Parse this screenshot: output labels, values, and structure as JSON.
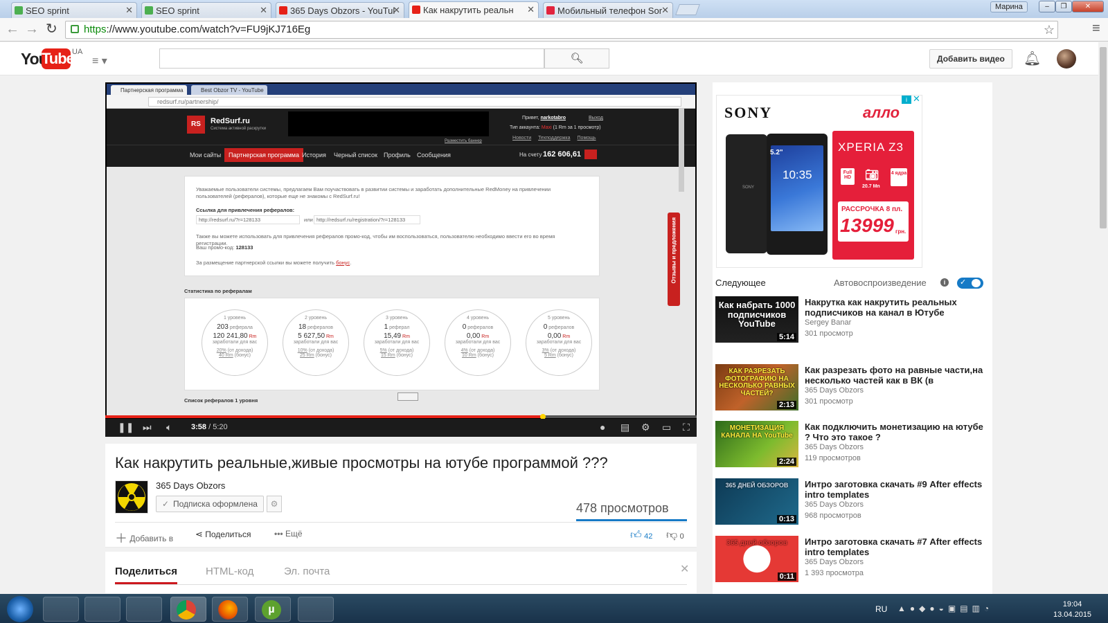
{
  "browser": {
    "tabs": [
      {
        "label": "SEO sprint",
        "favicon_color": "#4caf50"
      },
      {
        "label": "SEO sprint",
        "favicon_color": "#4caf50"
      },
      {
        "label": "365 Days Obzors - YouTul",
        "favicon_color": "#e62117"
      },
      {
        "label": "Как накрутить реальн",
        "favicon_color": "#e62117"
      },
      {
        "label": "Мобильный телефон Sor",
        "favicon_color": "#e2233d"
      }
    ],
    "user": "Марина",
    "url_scheme": "https",
    "url_rest": "://www.youtube.com/watch?v=FU9jKJ716Eg"
  },
  "youtube": {
    "logo_you": "You",
    "logo_tube": "Tube",
    "region": "UA",
    "add_video_label": "Добавить видео"
  },
  "player": {
    "time_current": "3:58",
    "time_total": "/ 5:20",
    "progress": 0.74
  },
  "inner": {
    "tab1": "Партнерская программа",
    "tab2": "Best Obzor TV - YouTube",
    "url": "redsurf.ru/partnership/",
    "site_name": "RedSurf.ru",
    "site_tagline": "Система активной раскрутки",
    "greeting": "Привет,",
    "username": "narkotabro",
    "logout": "Выход",
    "account_label": "Тип аккаунта:",
    "account_type": "Maxi",
    "account_note": "(1 Rm за 1 просмотр)",
    "banner_link": "Разместить баннер",
    "links": [
      "Новости",
      "Техподдержка",
      "Помощь"
    ],
    "nav": [
      "Мои сайты",
      "Партнерская программа",
      "История",
      "Черный список",
      "Профиль",
      "Сообщения"
    ],
    "balance_label": "На счету",
    "balance": "162 606,61",
    "intro": "Уважаемые пользователи системы, предлагаем Вам поучаствовать в развитии системы и заработать дополнительные RedMoney на привлечении пользователей (рефералов), которые еще не знакомы с RedSurf.ru!",
    "ref_link_label": "Ссылка для привлечения рефералов:",
    "ref_link1": "http://redsurf.ru/?r=128133",
    "or": "или",
    "ref_link2": "http://redsurf.ru/registration/?r=128133",
    "promo_text": "Также вы можете использовать для привлечения рефералов промо-код, чтобы им воспользоваться, пользователю необходимо ввести его во время регистрации.",
    "promo_label": "Ваш промо-код:",
    "promo_code": "128133",
    "bonus_text": "За размещение партнерской ссылки вы можете получить",
    "bonus_link": "бонус",
    "stats_title": "Статистика по рефералам",
    "list_title": "Список рефералов 1 уровня",
    "feedback": "Отзывы и предложения",
    "levels": [
      {
        "name": "1 уровень",
        "count": "203",
        "unit": "реферала",
        "sum": "120 241,80",
        "pct": "20%",
        "bonus": "40 Rm"
      },
      {
        "name": "2 уровень",
        "count": "18",
        "unit": "рефералов",
        "sum": "5 627,50",
        "pct": "10%",
        "bonus": "25 Rm"
      },
      {
        "name": "3 уровень",
        "count": "1",
        "unit": "реферал",
        "sum": "15,49",
        "pct": "5%",
        "bonus": "15 Rm"
      },
      {
        "name": "4 уровень",
        "count": "0",
        "unit": "рефералов",
        "sum": "0,00",
        "pct": "4%",
        "bonus": "10 Rm"
      },
      {
        "name": "5 уровень",
        "count": "0",
        "unit": "рефералов",
        "sum": "0,00",
        "pct": "3%",
        "bonus": "5 Rm"
      }
    ],
    "earned_label": "заработали для вас",
    "income_note": "(от дохода)",
    "bonus_note": "(бонус)",
    "rm": "Rm"
  },
  "video": {
    "title": "Как накрутить реальные,живые просмотры на ютубе программой ???",
    "channel": "365 Days Obzors",
    "subscribed_label": "Подписка оформлена",
    "views": "478 просмотров",
    "add_to": "Добавить в",
    "share": "Поделиться",
    "more": "Ещё",
    "likes": "42",
    "dislikes": "0"
  },
  "share_panel": {
    "tabs": [
      "Поделиться",
      "HTML-код",
      "Эл. почта"
    ]
  },
  "ad": {
    "brand": "SONY",
    "shop": "алло",
    "model": "XPERIA Z3",
    "icon1": "Full HD",
    "icon2": "20.7 Mn",
    "icon3": "4 ядра",
    "installment": "РАССРОЧКА 8 пл.",
    "price": "13999",
    "currency": "грн.",
    "phone_size": "5.2\"",
    "phone_time": "10:35"
  },
  "sidebar": {
    "next_label": "Следующее",
    "autoplay_label": "Автовоспроизведение",
    "autoplay_on": true,
    "items": [
      {
        "title": "Накрутка как накрутить реальных подписчиков на канал в Ютубе",
        "channel": "Sergey Banar",
        "views": "301 просмотр",
        "duration": "5:14",
        "thumb_text": "Как набрать 1000 подписчиков YouTube"
      },
      {
        "title": "Как разрезать фото на равные части,на несколько частей как в ВК (в",
        "channel": "365 Days Obzors",
        "views": "301 просмотр",
        "duration": "2:13",
        "thumb_text": "КАК РАЗРЕЗАТЬ ФОТОГРАФИЮ НА НЕСКОЛЬКО РАВНЫХ ЧАСТЕЙ?"
      },
      {
        "title": "Как подключить монетизацию на ютубе ? Что это такое ?",
        "channel": "365 Days Obzors",
        "views": "119 просмотров",
        "duration": "2:24",
        "thumb_text": "МОНЕТИЗАЦИЯ КАНАЛА НА YouTube"
      },
      {
        "title": "Интро заготовка скачать #9 After effects intro templates",
        "channel": "365 Days Obzors",
        "views": "968 просмотров",
        "duration": "0:13",
        "thumb_text": "365 ДНЕЙ ОБЗОРОВ"
      },
      {
        "title": "Интро заготовка скачать #7 After effects intro templates",
        "channel": "365 Days Obzors",
        "views": "1 393 просмотра",
        "duration": "0:11",
        "thumb_text": "365 дней обзоров"
      }
    ]
  },
  "taskbar": {
    "lang": "RU",
    "time": "19:04",
    "date": "13.04.2015"
  }
}
